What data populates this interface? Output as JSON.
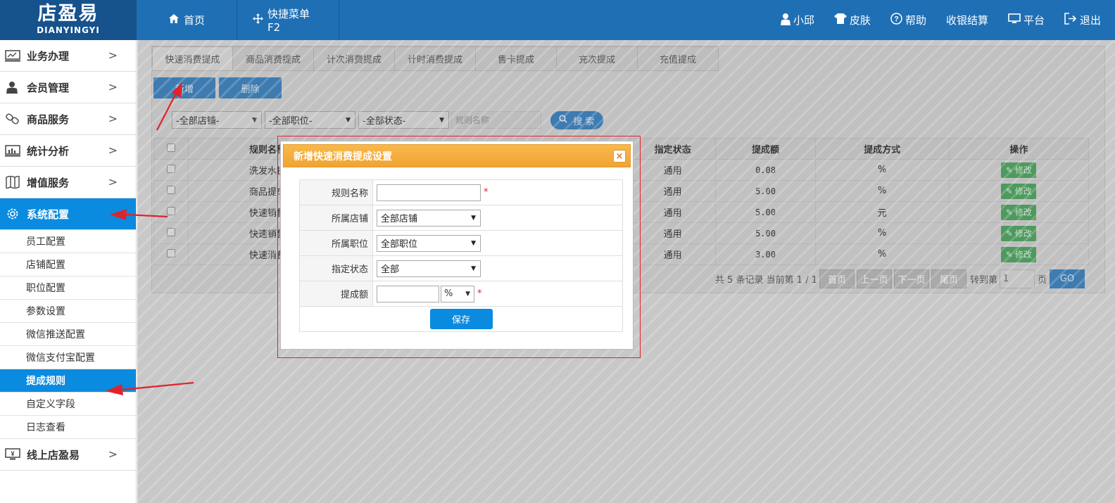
{
  "header": {
    "logo_cn": "店盈易",
    "logo_en": "DIANYINGYI",
    "nav": [
      {
        "label": "首页",
        "icon": "home-icon"
      },
      {
        "label": "快捷菜单 F2",
        "icon": "move-icon"
      }
    ],
    "right": [
      {
        "label": "小邱",
        "icon": "user-icon"
      },
      {
        "label": "皮肤",
        "icon": "shirt-icon"
      },
      {
        "label": "帮助",
        "icon": "help-icon"
      },
      {
        "label": "收银结算",
        "icon": ""
      },
      {
        "label": "平台",
        "icon": "monitor-icon"
      },
      {
        "label": "退出",
        "icon": "logout-icon"
      }
    ]
  },
  "sidebar": {
    "items": [
      {
        "label": "业务办理",
        "icon": "business-icon"
      },
      {
        "label": "会员管理",
        "icon": "member-icon"
      },
      {
        "label": "商品服务",
        "icon": "product-icon"
      },
      {
        "label": "统计分析",
        "icon": "chart-icon"
      },
      {
        "label": "增值服务",
        "icon": "map-icon"
      },
      {
        "label": "系统配置",
        "icon": "gear-icon"
      }
    ],
    "submenu": [
      "员工配置",
      "店铺配置",
      "职位配置",
      "参数设置",
      "微信推送配置",
      "微信支付宝配置",
      "提成规则",
      "自定义字段",
      "日志查看"
    ],
    "bottom_item": {
      "label": "线上店盈易",
      "icon": "yen-monitor-icon"
    }
  },
  "tabs": [
    "快速消费提成",
    "商品消费提成",
    "计次消费提成",
    "计时消费提成",
    "售卡提成",
    "充次提成",
    "充值提成"
  ],
  "toolbar": {
    "add": "新增",
    "delete": "删除"
  },
  "filters": {
    "store": "-全部店铺-",
    "position": "-全部职位-",
    "status": "-全部状态-",
    "name_placeholder": "规则名称",
    "search": "搜 索"
  },
  "table": {
    "headers": [
      "规则名称",
      "指定状态",
      "提成额",
      "提成方式",
      "操作"
    ],
    "rows": [
      {
        "name": "洗发水提",
        "status": "通用",
        "amount": "0.08",
        "method": "%"
      },
      {
        "name": "商品提成",
        "status": "通用",
        "amount": "5.00",
        "method": "%"
      },
      {
        "name": "快速销售",
        "status": "通用",
        "amount": "5.00",
        "method": "元"
      },
      {
        "name": "快速销售",
        "status": "通用",
        "amount": "5.00",
        "method": "%"
      },
      {
        "name": "快速消费",
        "status": "通用",
        "amount": "3.00",
        "method": "%"
      }
    ],
    "edit_label": "修改"
  },
  "pager": {
    "summary": "共 5 条记录 当前第 1 / 1",
    "first": "首页",
    "prev": "上一页",
    "next": "下一页",
    "last": "尾页",
    "goto_label": "转到第",
    "page_value": "1",
    "page_unit": "页",
    "go": "GO"
  },
  "modal": {
    "title": "新增快速消费提成设置",
    "close": "×",
    "fields": {
      "rule_name_label": "规则名称",
      "store_label": "所属店铺",
      "store_value": "全部店铺",
      "position_label": "所属职位",
      "position_value": "全部职位",
      "status_label": "指定状态",
      "status_value": "全部",
      "amount_label": "提成额",
      "amount_unit": "%"
    },
    "required_mark": "*",
    "save": "保存"
  }
}
